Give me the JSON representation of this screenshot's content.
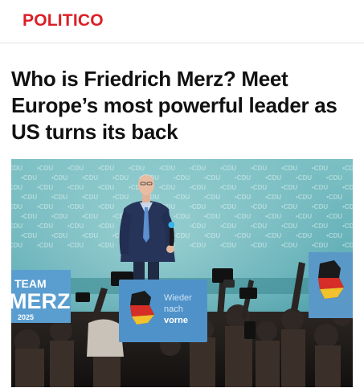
{
  "brand": {
    "name": "POLITICO",
    "color": "#dc1f26"
  },
  "article": {
    "headline": "Who is Friedrich Merz? Meet Europe’s most powerful leader as US turns its back"
  },
  "photo": {
    "backdrop_text": "CDU",
    "sign_left": {
      "line1": "TEAM",
      "line2": "MERZ",
      "line3": "2025"
    },
    "sign_center": {
      "line1": "Wieder",
      "line2": "nach",
      "line3": "vorne"
    }
  }
}
